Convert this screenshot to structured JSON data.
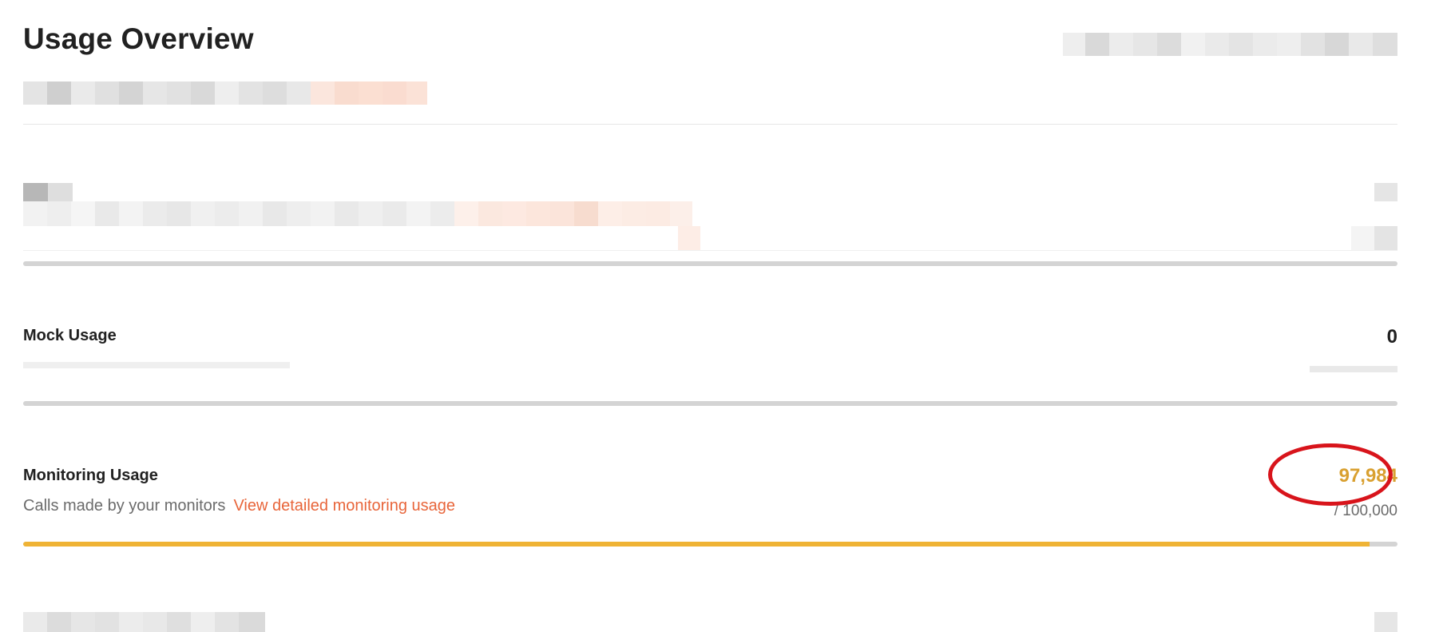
{
  "page": {
    "title": "Usage Overview"
  },
  "sections": {
    "mock": {
      "label": "Mock Usage",
      "value": "0",
      "progress": 0
    },
    "monitoring": {
      "label": "Monitoring Usage",
      "description": "Calls made by your monitors",
      "link": "View detailed monitoring usage",
      "value": "97,984",
      "limit": "/ 100,000",
      "progress": 0.97984
    }
  },
  "colors": {
    "accent_link": "#e8653a",
    "warning_value": "#d9a030",
    "progress_fill": "#efb335",
    "progress_track": "#d4d4d4",
    "highlight_ring": "#d8141b"
  },
  "icons": {}
}
